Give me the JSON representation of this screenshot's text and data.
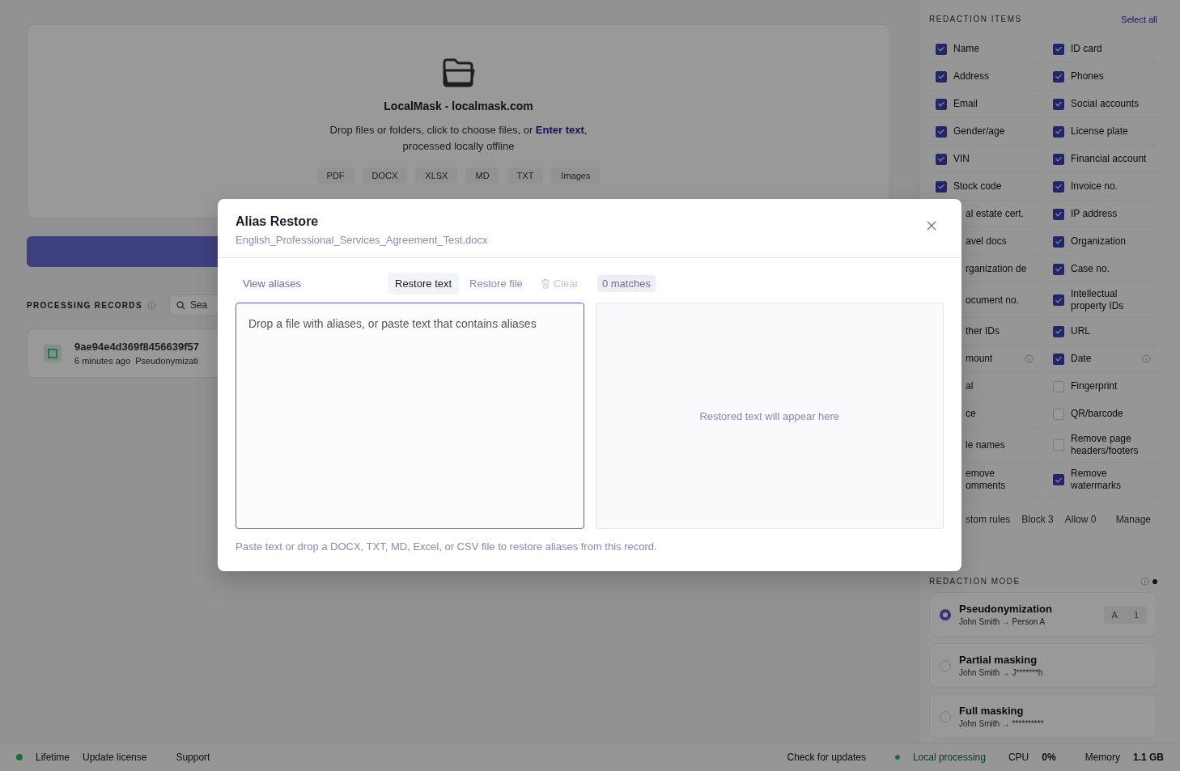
{
  "upload": {
    "title": "LocalMask - localmask.com",
    "subtitle_start": "Drop files or folders, click to choose files, or ",
    "subtitle_link": "Enter text",
    "subtitle_end": ",",
    "subtitle_line2": "processed locally offline",
    "formats": [
      "PDF",
      "DOCX",
      "XLSX",
      "MD",
      "TXT",
      "Images"
    ]
  },
  "records": {
    "heading": "PROCESSING RECORDS",
    "search": {
      "placeholder": "Sea"
    },
    "items": [
      {
        "name": "9ae94e4d369f8456639f57",
        "time": "6 minutes ago",
        "mode": "Pseudonymizati"
      }
    ]
  },
  "sidebar": {
    "heading": "REDACTION ITEMS",
    "select_all": "Select all",
    "items": [
      {
        "kind": "item",
        "label": "Name",
        "checked": true
      },
      {
        "kind": "item",
        "label": "ID card",
        "checked": true
      },
      {
        "kind": "item",
        "label": "Address",
        "checked": true
      },
      {
        "kind": "item",
        "label": "Phones",
        "checked": true
      },
      {
        "kind": "item",
        "label": "Email",
        "checked": true
      },
      {
        "kind": "item",
        "label": "Social accounts",
        "checked": true
      },
      {
        "kind": "item",
        "label": "Gender/age",
        "checked": true
      },
      {
        "kind": "item",
        "label": "License plate",
        "checked": true
      },
      {
        "kind": "item",
        "label": "VIN",
        "checked": true
      },
      {
        "kind": "item",
        "label": "Financial account",
        "checked": true
      },
      {
        "kind": "item",
        "label": "Stock code",
        "checked": true
      },
      {
        "kind": "item",
        "label": "Invoice no.",
        "checked": true
      },
      {
        "kind": "partial",
        "label": "al estate cert."
      },
      {
        "kind": "item",
        "label": "IP address",
        "checked": true
      },
      {
        "kind": "partial",
        "label": "avel docs"
      },
      {
        "kind": "item",
        "label": "Organization",
        "checked": true
      },
      {
        "kind": "partial",
        "label": "rganization de"
      },
      {
        "kind": "item",
        "label": "Case no.",
        "checked": true
      },
      {
        "kind": "partial",
        "label": "ocument no."
      },
      {
        "kind": "item",
        "label": "Intellectual property IDs",
        "checked": true
      },
      {
        "kind": "partial",
        "label": "ther IDs"
      },
      {
        "kind": "item",
        "label": "URL",
        "checked": true
      },
      {
        "kind": "partial",
        "label": "mount",
        "info": true
      },
      {
        "kind": "item",
        "label": "Date",
        "checked": true,
        "info": true
      },
      {
        "kind": "partial",
        "label": "al"
      },
      {
        "kind": "item",
        "label": "Fingerprint",
        "checked": false
      },
      {
        "kind": "partial",
        "label": "ce"
      },
      {
        "kind": "item",
        "label": "QR/barcode",
        "checked": false
      },
      {
        "kind": "partial",
        "label": "le names"
      },
      {
        "kind": "item",
        "label": "Remove page headers/footers",
        "checked": false
      },
      {
        "kind": "partial",
        "label": "emove omments"
      },
      {
        "kind": "item",
        "label": "Remove watermarks",
        "checked": true
      }
    ],
    "custom_rules": {
      "label": "stom rules",
      "block": "Block 3",
      "allow": "Allow 0",
      "manage": "Manage"
    },
    "mode_heading": "REDACTION MODE",
    "modes": [
      {
        "title": "Pseudonymization",
        "example": "John Smith → Person A",
        "selected": true,
        "styles": [
          "A",
          "1"
        ]
      },
      {
        "title": "Partial masking",
        "example": "John Smith → J*******h",
        "selected": false
      },
      {
        "title": "Full masking",
        "example": "John Smith → **********",
        "selected": false
      }
    ]
  },
  "status_bar": {
    "plan": "Lifetime",
    "update_license": "Update license",
    "support": "Support",
    "check_updates": "Check for updates",
    "local": "Local processing",
    "cpu_label": "CPU",
    "cpu": "0%",
    "memory_label": "Memory",
    "memory": "1.1 GB"
  },
  "dialog": {
    "title": "Alias Restore",
    "filename": "English_Professional_Services_Agreement_Test.docx",
    "view_aliases": "View aliases",
    "tabs": [
      {
        "label": "Restore text",
        "selected": true
      },
      {
        "label": "Restore file",
        "selected": false
      }
    ],
    "clear": {
      "label": "Clear",
      "disabled": true
    },
    "matches": "0 matches",
    "input": {
      "placeholder": "Drop a file with aliases, or paste text that contains aliases"
    },
    "output_placeholder": "Restored text will appear here",
    "hint": "Paste text or drop a DOCX, TXT, MD, Excel, or CSV file to restore aliases from this record."
  }
}
